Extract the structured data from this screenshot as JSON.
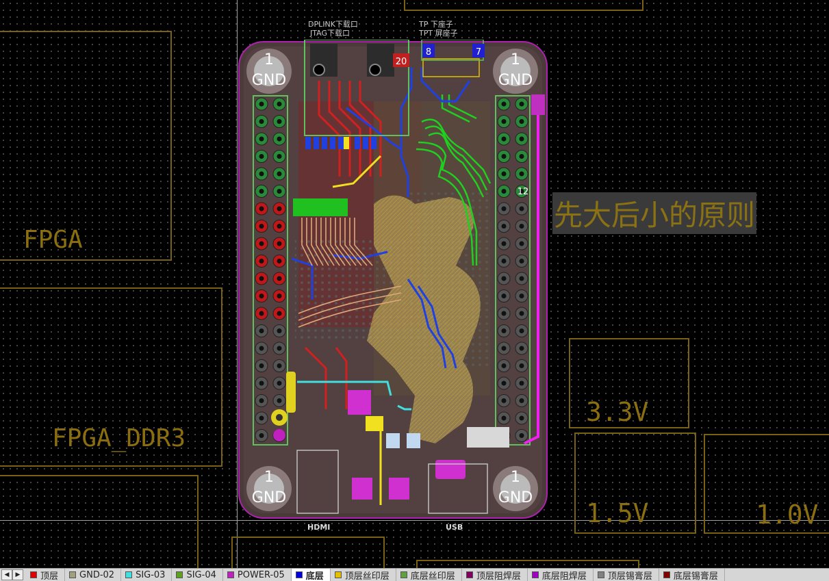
{
  "board_labels": {
    "fpga": "FPGA",
    "fpga_ddr3": "FPGA_DDR3",
    "v33": "3.3V",
    "v15": "1.5V",
    "v10": "1.0V",
    "principle": "先大后小的原则"
  },
  "silk": {
    "dplink": "DPLINK下载口",
    "jtag": "JTAG下载口",
    "tp_fpc": "TP 下座子",
    "tpt": "TPT 屏座子",
    "hdmi": "HDMI",
    "usb": "USB",
    "gnd": "GND",
    "one": "1",
    "pin12": "12",
    "pin8": "8",
    "pin7": "7",
    "pin20": "20"
  },
  "layer_tabs": [
    {
      "label": "顶层",
      "color": "#e00000",
      "active": false
    },
    {
      "label": "GND-02",
      "color": "#a0a080",
      "active": false
    },
    {
      "label": "SIG-03",
      "color": "#40e0e0",
      "active": false
    },
    {
      "label": "SIG-04",
      "color": "#60a020",
      "active": false
    },
    {
      "label": "POWER-05",
      "color": "#c020c0",
      "active": false
    },
    {
      "label": "底层",
      "color": "#0000e0",
      "active": true
    },
    {
      "label": "顶层丝印层",
      "color": "#e0c000",
      "active": false
    },
    {
      "label": "底层丝印层",
      "color": "#60a040",
      "active": false
    },
    {
      "label": "顶层阻焊层",
      "color": "#800060",
      "active": false
    },
    {
      "label": "底层阻焊层",
      "color": "#a000c0",
      "active": false
    },
    {
      "label": "顶层锡膏层",
      "color": "#808080",
      "active": false
    },
    {
      "label": "底层锡膏层",
      "color": "#800000",
      "active": false
    }
  ]
}
